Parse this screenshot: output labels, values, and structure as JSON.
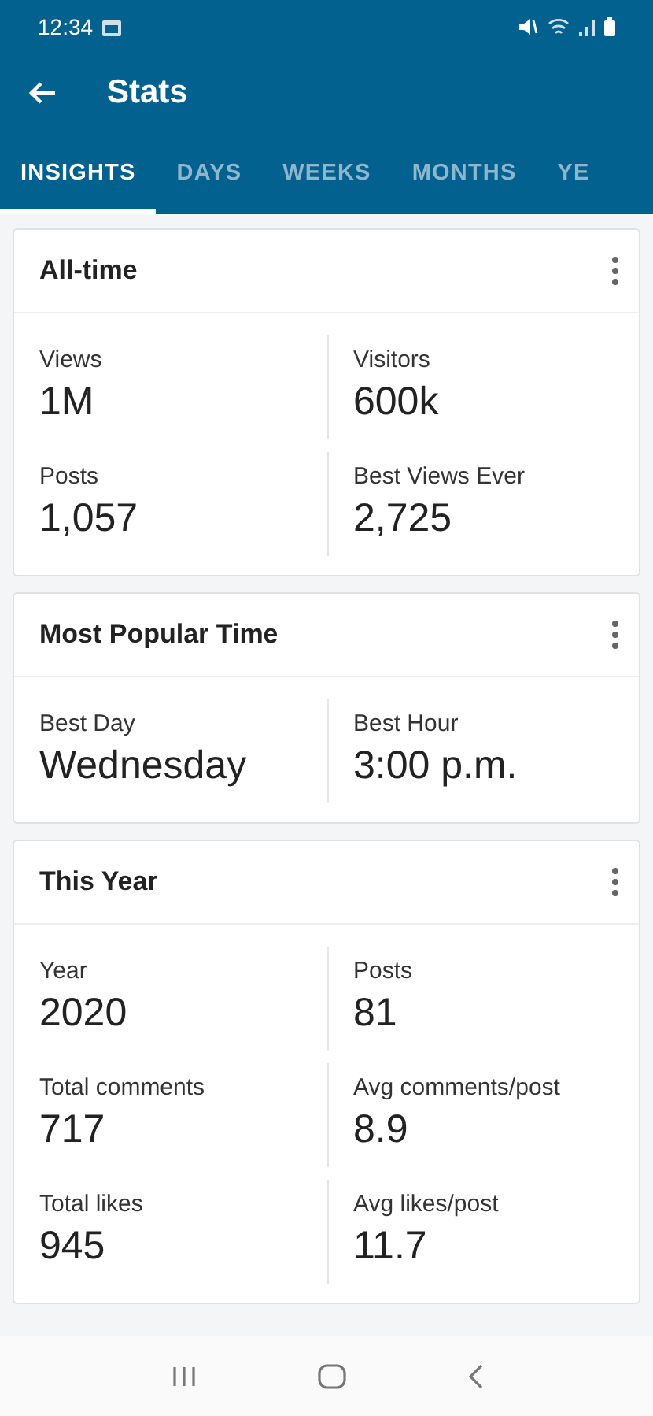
{
  "status_bar": {
    "time": "12:34"
  },
  "toolbar": {
    "title": "Stats"
  },
  "tabs": [
    {
      "label": "INSIGHTS",
      "selected": true
    },
    {
      "label": "DAYS",
      "selected": false
    },
    {
      "label": "WEEKS",
      "selected": false
    },
    {
      "label": "MONTHS",
      "selected": false
    },
    {
      "label": "YE",
      "selected": false
    }
  ],
  "cards": [
    {
      "title": "All-time",
      "stats": [
        {
          "label": "Views",
          "value": "1M"
        },
        {
          "label": "Visitors",
          "value": "600k"
        },
        {
          "label": "Posts",
          "value": "1,057"
        },
        {
          "label": "Best Views Ever",
          "value": "2,725"
        }
      ]
    },
    {
      "title": "Most Popular Time",
      "stats": [
        {
          "label": "Best Day",
          "value": "Wednesday"
        },
        {
          "label": "Best Hour",
          "value": "3:00 p.m."
        }
      ]
    },
    {
      "title": "This Year",
      "stats": [
        {
          "label": "Year",
          "value": "2020"
        },
        {
          "label": "Posts",
          "value": "81"
        },
        {
          "label": "Total comments",
          "value": "717"
        },
        {
          "label": "Avg comments/post",
          "value": "8.9"
        },
        {
          "label": "Total likes",
          "value": "945"
        },
        {
          "label": "Avg likes/post",
          "value": "11.7"
        }
      ]
    }
  ]
}
